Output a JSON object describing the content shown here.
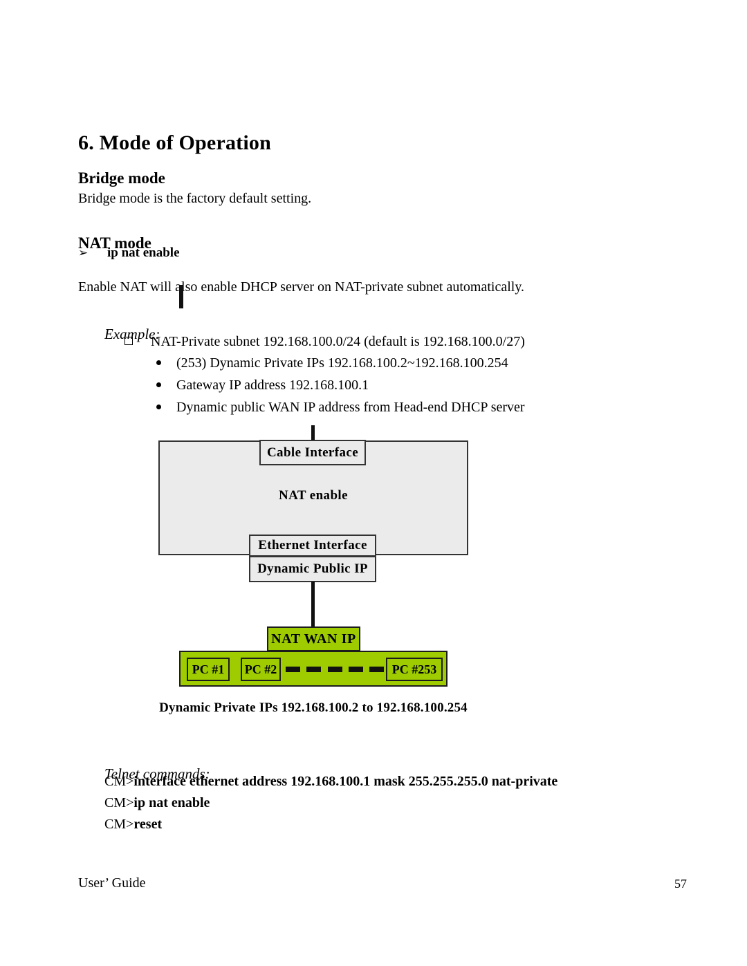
{
  "document": {
    "heading": "6. Mode of Operation",
    "sections": {
      "bridge": {
        "title": "Bridge mode",
        "description": "Bridge mode is the factory default setting."
      },
      "nat": {
        "title": "NAT mode",
        "command_bullet": "ip nat enable",
        "arrow_glyph": "➢",
        "description": "Enable NAT will also enable DHCP server on NAT-private subnet automatically.",
        "example_label": "Example:",
        "bullets": {
          "square": "NAT-Private subnet 192.168.100.0/24 (default is 192.168.100.0/27)",
          "dots": [
            "(253) Dynamic Private IPs 192.168.100.2~192.168.100.254",
            "Gateway IP address 192.168.100.1",
            "Dynamic public WAN IP address from Head-end DHCP server"
          ]
        }
      }
    },
    "diagram": {
      "modem_label": "NAT enable",
      "cable_interface": "Cable Interface",
      "ethernet_interface": "Ethernet  Interface",
      "dynamic_public_ip": "Dynamic Public  IP",
      "nat_wan_ip": "NAT WAN IP",
      "pcs": [
        "PC #1",
        "PC #2",
        "PC #253"
      ],
      "dash_count": 5,
      "caption": "Dynamic Private IPs 192.168.100.2 to 192.168.100.254",
      "colors": {
        "modem_fill": "#ebebeb",
        "box_border": "#333333",
        "lan_fill": "#9ecc00",
        "lan_border": "#1c1c1c",
        "connector": "#111111"
      }
    },
    "telnet": {
      "label": "Telnet commands:",
      "commands": [
        {
          "prompt": "CM>",
          "text": "interface ethernet address 192.168.100.1 mask 255.255.255.0 nat-private"
        },
        {
          "prompt": "CM>",
          "text": "ip nat enable"
        },
        {
          "prompt": "CM>",
          "text": "reset"
        }
      ]
    },
    "footer": {
      "left": "User’ Guide",
      "page_number": "57"
    }
  }
}
